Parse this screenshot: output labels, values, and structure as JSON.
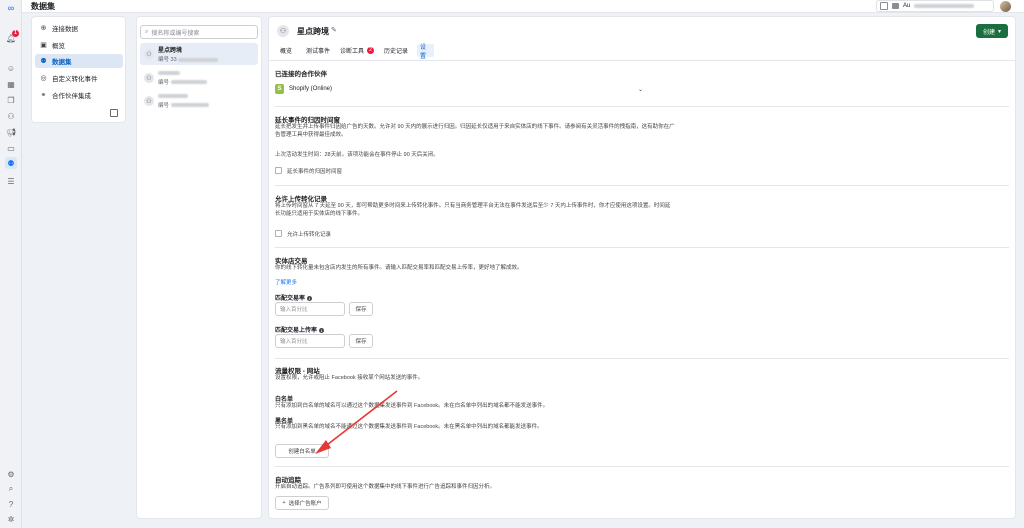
{
  "app": {
    "title": "数据集"
  },
  "topbar": {
    "account_initials": "Au"
  },
  "nav": {
    "items": [
      {
        "label": "连接数据",
        "icon": "plus-circle-icon"
      },
      {
        "label": "概览",
        "icon": "overview-icon"
      },
      {
        "label": "数据集",
        "icon": "dataset-icon",
        "active": true
      },
      {
        "label": "自定义转化事件",
        "icon": "custom-conversion-icon"
      },
      {
        "label": "合作伙伴集成",
        "icon": "partner-integration-icon"
      }
    ]
  },
  "rail": {
    "notification_count": "1"
  },
  "dataset_list": {
    "search_placeholder": "搜名称或编号搜索",
    "items": [
      {
        "name": "星点跨境",
        "id_prefix": "编号 33"
      },
      {
        "name": "",
        "id_prefix": "编号"
      },
      {
        "name": "",
        "id_prefix": "编号"
      }
    ]
  },
  "main": {
    "title": "星点跨境",
    "create_button": "创建",
    "tabs": [
      {
        "label": "概览"
      },
      {
        "label": "测试事件"
      },
      {
        "label": "诊断工具",
        "badge": "2"
      },
      {
        "label": "历史记录"
      },
      {
        "label": "设置",
        "active": true
      }
    ],
    "partner": {
      "title": "已连接的合作伙伴",
      "value": "Shopify (Online)"
    },
    "attribution": {
      "title": "延长事件的归因时间窗",
      "desc": "延长把发生并上传事件归因给广告的天数。允许对 90 天内的展示进行归因。归因延长仅适用于来自实体店的线下事件。请参阅有关灵活事件的拽指南，这有助你在广告管理工具中获得最佳成效。",
      "last_event": "上次活动发生时间：28天前。该项功能会在事件停止 90 天后关闭。",
      "checkbox_label": "延长事件的归因时间窗"
    },
    "upload": {
      "title": "允许上传转化记录",
      "desc": "将上传时间窗从 7 天延至 90 天，即可帮助更多时间来上传转化事件。只有当商务管理平台无法在事件发送后至少 7 天内上传事件时，你才应使用这项设置。时间延长功能只适用于实体店的线下事件。",
      "checkbox_label": "允许上传转化记录"
    },
    "store": {
      "title": "实体店交易",
      "desc": "你的线下转化量未包含店内发生的所有事件。请输入匹配交易率和匹配交易上传率，更好地了解成效。",
      "learn_more": "了解更多",
      "match_rate_label": "匹配交易率",
      "match_upload_label": "匹配交易上传率",
      "input_placeholder": "输入百分比",
      "save_label": "保存"
    },
    "traffic": {
      "title": "流量权限 - 网站",
      "desc": "设置权限，允许或阻止 Facebook 接收某个网站发送的事件。",
      "allowlist_title": "白名单",
      "allowlist_desc": "只有添加到白名单的域名可以通过这个数据集发送事件到 Facebook。未在白名单中列出的域名都不能发送事件。",
      "blocklist_title": "黑名单",
      "blocklist_desc": "只有添加到黑名单的域名不能通过这个数据集发送事件到 Facebook。未在黑名单中列出的域名都能发送事件。",
      "create_allowlist": "创建白名单"
    },
    "auto_tracking": {
      "title": "自动追踪",
      "desc": "开启自动追踪。广告系列即可使用这个数据集中的线下事件进行广告追踪和事件归因分析。",
      "select_account": "选择广告账户"
    }
  }
}
